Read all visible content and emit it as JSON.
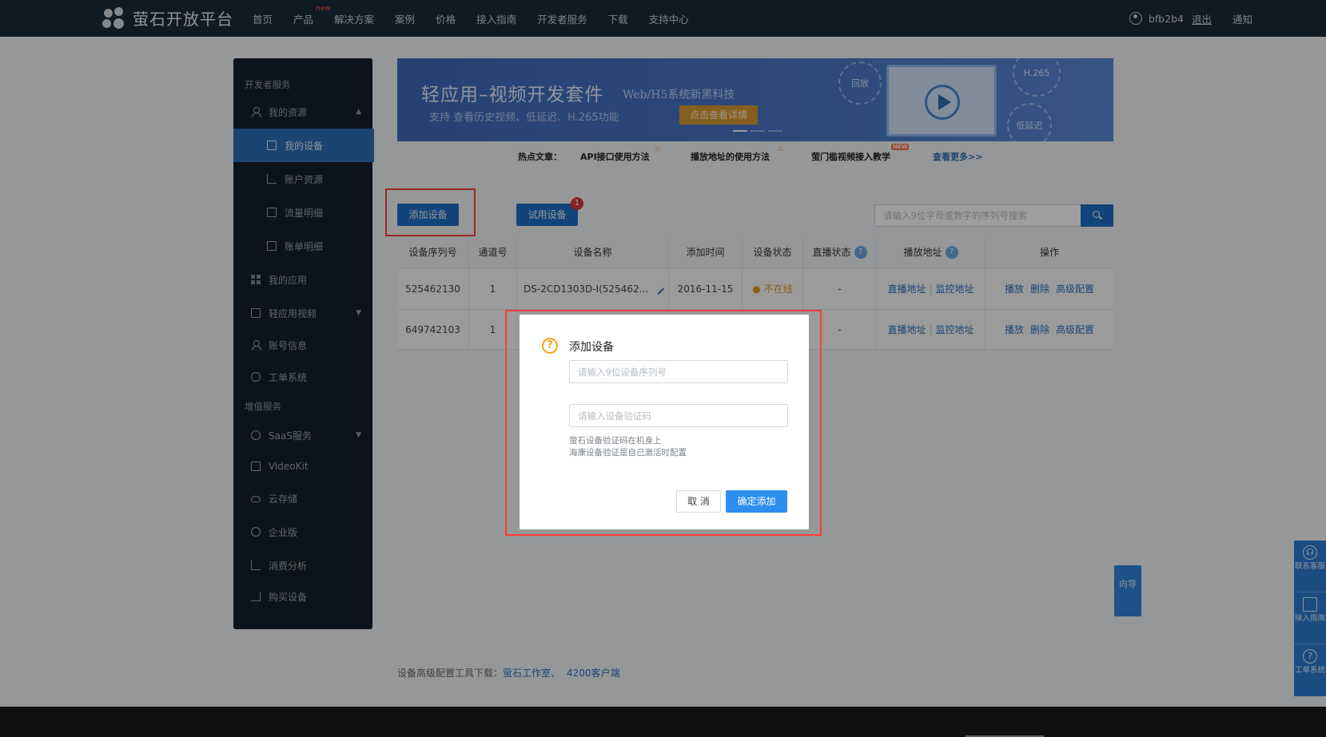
{
  "topnav": {
    "brand": "萤石开放平台",
    "items": [
      {
        "label": "首页"
      },
      {
        "label": "产品",
        "tag": "new"
      },
      {
        "label": "解决方案"
      },
      {
        "label": "案例"
      },
      {
        "label": "价格"
      },
      {
        "label": "接入指南"
      },
      {
        "label": "开发者服务"
      },
      {
        "label": "下载"
      },
      {
        "label": "支持中心"
      }
    ],
    "username": "bfb2b4",
    "logout": "退出",
    "notify": "通知"
  },
  "sidebar": {
    "section1": "开发者服务",
    "my_resources": "我的资源",
    "my_devices": "我的设备",
    "account_resources": "账户资源",
    "traffic_details": "流量明细",
    "bill_details": "账单明细",
    "my_apps": "我的应用",
    "light_video": "轻应用视频",
    "account_info": "账号信息",
    "ticket_system": "工单系统",
    "section2": "增值服务",
    "saas": "SaaS服务",
    "videokit": "VideoKit",
    "cloud_storage": "云存储",
    "enterprise": "企业版",
    "consumption": "消费分析",
    "buy_device": "购买设备"
  },
  "banner": {
    "title": "轻应用–视频开发套件",
    "subtitle_en": "Web/H5系统新黑科技",
    "subtitle": "支持 查看历史视频、低延迟、H.265功能",
    "button": "点击查看详情",
    "ring_playback": "回放",
    "ring_low_latency": "低延迟",
    "ring_h265": "H.265"
  },
  "hot": {
    "label": "热点文章：",
    "a1": "API接口使用方法",
    "a2": "播放地址的使用方法",
    "a3": "萤门槛视频接入教学",
    "new_tag": "NEW",
    "more": "查看更多>>"
  },
  "actions": {
    "add_device": "添加设备",
    "trial_device": "试用设备",
    "trial_badge": "1",
    "search_placeholder": "请输入9位字母或数字的序列号搜索"
  },
  "table": {
    "headers": [
      "设备序列号",
      "通道号",
      "设备名称",
      "添加时间",
      "设备状态",
      "直播状态",
      "播放地址",
      "操作"
    ],
    "help_mark": "?",
    "rows": [
      {
        "serial": "525462130",
        "channel": "1",
        "name": "DS-2CD1303D-I(525462...",
        "added": "2016-11-15",
        "status": "不在线",
        "live": "-",
        "live_url": "直播地址",
        "monitor_url": "监控地址",
        "play": "播放",
        "delete": "删除",
        "advanced": "高级配置"
      },
      {
        "serial": "649742103",
        "channel": "1",
        "name": "",
        "added": "",
        "status": "",
        "live": "-",
        "live_url": "直播地址",
        "monitor_url": "监控地址",
        "play": "播放",
        "delete": "删除",
        "advanced": "高级配置"
      }
    ]
  },
  "footer": {
    "prefix": "设备高级配置工具下载：",
    "link1": "萤石工作室、",
    "link2": "4200客户端"
  },
  "float": {
    "guide": "向导",
    "contact": "联系客服",
    "access_guide": "接入指南",
    "ticket": "工单系统"
  },
  "modal": {
    "title": "添加设备",
    "icon": "?",
    "serial_placeholder": "请输入9位设备序列号",
    "code_placeholder": "请输入设备验证码",
    "hint1": "萤石设备验证码在机身上",
    "hint2": "海康设备验证是自己激活时配置",
    "cancel": "取 消",
    "confirm": "确定添加"
  },
  "colors": {
    "nav_bg": "#1a2a3b",
    "sidebar_bg": "#15202c",
    "primary": "#1f6fc4",
    "highlight_red": "#ff3b3b",
    "confirm_blue": "#2d8ef0",
    "warning": "#f5a623"
  }
}
